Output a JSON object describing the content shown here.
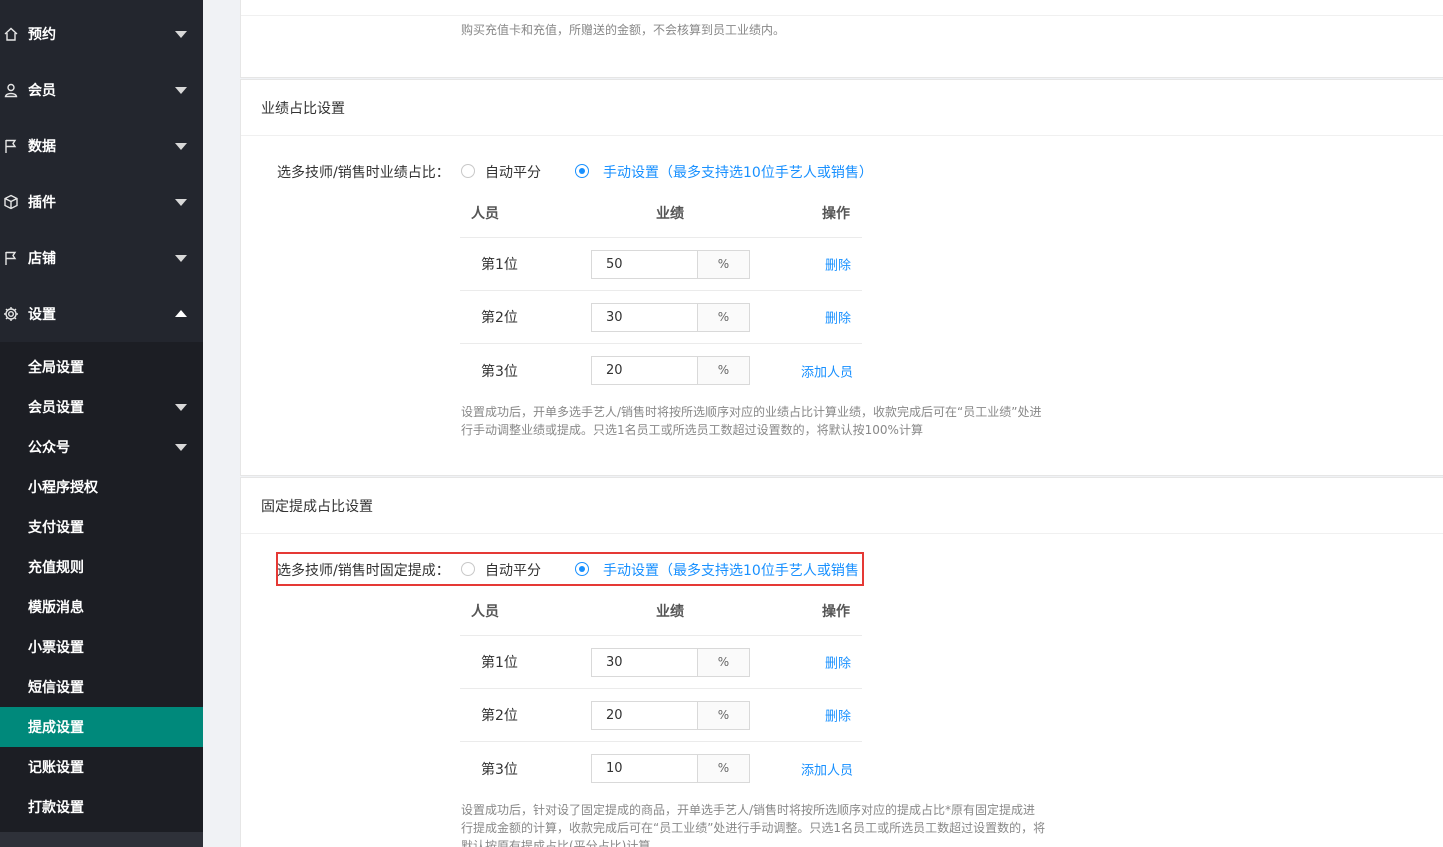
{
  "sidebar": {
    "menu": [
      {
        "label": "预约",
        "icon": "home-icon",
        "expanded": false
      },
      {
        "label": "会员",
        "icon": "user-icon",
        "expanded": false
      },
      {
        "label": "数据",
        "icon": "flag-icon",
        "expanded": false
      },
      {
        "label": "插件",
        "icon": "cube-icon",
        "expanded": false
      },
      {
        "label": "店铺",
        "icon": "flag-icon",
        "expanded": false
      },
      {
        "label": "设置",
        "icon": "gear-icon",
        "expanded": true
      }
    ],
    "submenu": [
      {
        "label": "全局设置",
        "has_children": false,
        "active": false
      },
      {
        "label": "会员设置",
        "has_children": true,
        "active": false
      },
      {
        "label": "公众号",
        "has_children": true,
        "active": false
      },
      {
        "label": "小程序授权",
        "has_children": false,
        "active": false
      },
      {
        "label": "支付设置",
        "has_children": false,
        "active": false
      },
      {
        "label": "充值规则",
        "has_children": false,
        "active": false
      },
      {
        "label": "模版消息",
        "has_children": false,
        "active": false
      },
      {
        "label": "小票设置",
        "has_children": false,
        "active": false
      },
      {
        "label": "短信设置",
        "has_children": false,
        "active": false
      },
      {
        "label": "提成设置",
        "has_children": false,
        "active": true
      },
      {
        "label": "记账设置",
        "has_children": false,
        "active": false
      },
      {
        "label": "打款设置",
        "has_children": false,
        "active": false
      }
    ],
    "active_color": "#00897b"
  },
  "main": {
    "top_hint": "购买充值卡和充值，所赠送的金额，不会核算到员工业绩内。",
    "performance_section": {
      "title": "业绩占比设置",
      "row_label": "选多技师/销售时业绩占比：",
      "option_auto": "自动平分",
      "option_manual": "手动设置（最多支持选10位手艺人或销售）",
      "selected": "manual",
      "table": {
        "headers": [
          "人员",
          "业绩",
          "操作"
        ],
        "rows": [
          {
            "name": "第1位",
            "value": "50",
            "unit": "%",
            "action": "删除"
          },
          {
            "name": "第2位",
            "value": "30",
            "unit": "%",
            "action": "删除"
          },
          {
            "name": "第3位",
            "value": "20",
            "unit": "%",
            "action": "添加人员"
          }
        ]
      },
      "hint_line1": "设置成功后，开单多选手艺人/销售时将按所选顺序对应的业绩占比计算业绩，收款完成后可在“员工业绩”处进",
      "hint_line2": "行手动调整业绩或提成。只选1名员工或所选员工数超过设置数的，将默认按100%计算"
    },
    "commission_section": {
      "title": "固定提成占比设置",
      "row_label": "选多技师/销售时固定提成：",
      "option_auto": "自动平分",
      "option_manual": "手动设置（最多支持选10位手艺人或销售",
      "selected": "manual",
      "table": {
        "headers": [
          "人员",
          "业绩",
          "操作"
        ],
        "rows": [
          {
            "name": "第1位",
            "value": "30",
            "unit": "%",
            "action": "删除"
          },
          {
            "name": "第2位",
            "value": "20",
            "unit": "%",
            "action": "删除"
          },
          {
            "name": "第3位",
            "value": "10",
            "unit": "%",
            "action": "添加人员"
          }
        ]
      },
      "hint_line1": "设置成功后，针对设了固定提成的商品，开单选手艺人/销售时将按所选顺序对应的提成占比*原有固定提成进",
      "hint_line2": "行提成金额的计算，收款完成后可在“员工业绩”处进行手动调整。只选1名员工或所选员工数超过设置数的，将",
      "hint_line3": "默认按原有提成占比(平分占比)计算"
    },
    "link_color": "#1890ff",
    "highlight_color": "#e53935"
  }
}
